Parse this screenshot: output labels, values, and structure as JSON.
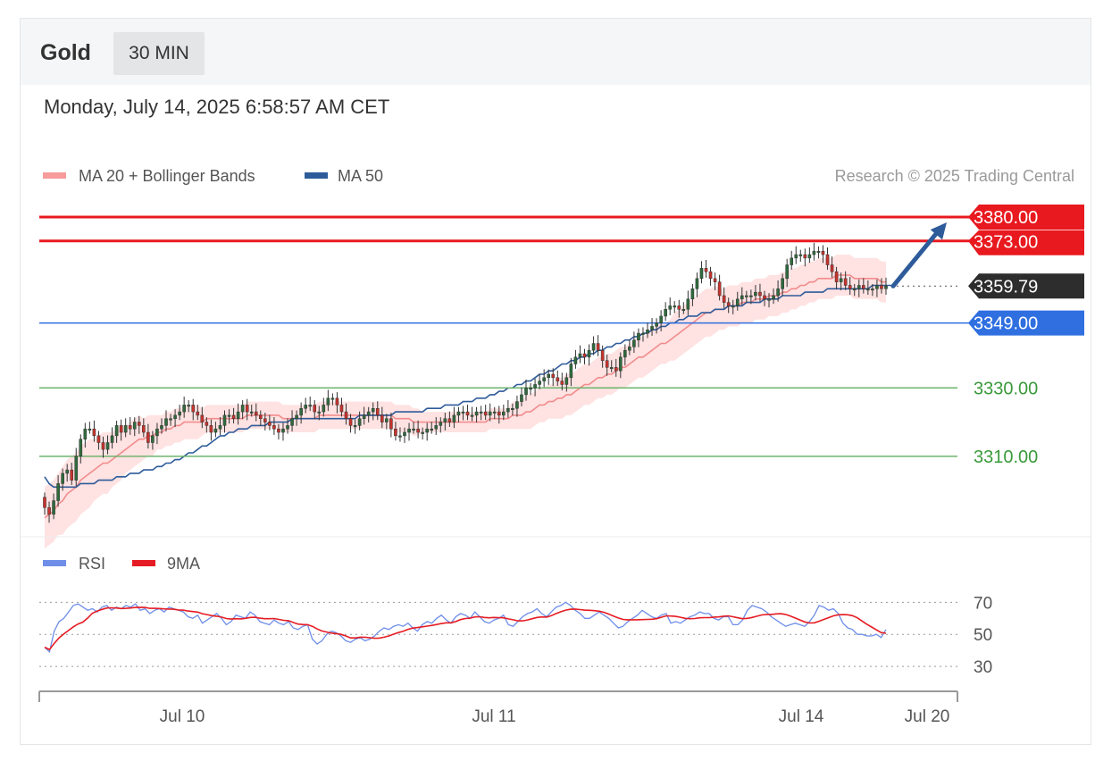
{
  "header": {
    "symbol": "Gold",
    "interval": "30 MIN",
    "datetime": "Monday, July 14, 2025 6:58:57 AM CET"
  },
  "legend": {
    "ma20_bollinger": "MA 20 + Bollinger Bands",
    "ma50": "MA 50",
    "credit": "Research © 2025 Trading Central",
    "rsi": "RSI",
    "rsi_ma": "9MA"
  },
  "colors": {
    "bull": "#2e6b3c",
    "bear": "#c8322d",
    "resistance": "#e8191f",
    "support_primary": "#2f6fe0",
    "support_secondary": "#6db46d",
    "ma20": "#f28c8c",
    "bands": "#ffd6d6",
    "ma50": "#2e5b9a",
    "rsi": "#6e8ee8",
    "rsi_ma": "#e51c23",
    "last_price_bg": "#2d2d2d",
    "arrow": "#2e5b9a"
  },
  "chart_data": {
    "type": "candlestick",
    "ylim": [
      3288,
      3386
    ],
    "x_ticks": [
      "Jul 10",
      "Jul 11",
      "Jul 14",
      "Jul 20"
    ],
    "levels": [
      {
        "value": 3380.0,
        "label": "3380.00",
        "kind": "resistance"
      },
      {
        "value": 3373.0,
        "label": "3373.00",
        "kind": "resistance"
      },
      {
        "value": 3359.79,
        "label": "3359.79",
        "kind": "last"
      },
      {
        "value": 3349.0,
        "label": "3349.00",
        "kind": "pivot"
      },
      {
        "value": 3330.0,
        "label": "3330.00",
        "kind": "support"
      },
      {
        "value": 3310.0,
        "label": "3310.00",
        "kind": "support"
      }
    ],
    "target_arrow": {
      "from": 3359.79,
      "to": 3380.0
    },
    "close": [
      3295,
      3293,
      3297,
      3302,
      3305,
      3306,
      3303,
      3310,
      3315,
      3318,
      3318,
      3316,
      3314,
      3312,
      3314,
      3316,
      3319,
      3317,
      3319,
      3318,
      3320,
      3319,
      3317,
      3314,
      3316,
      3318,
      3319,
      3321,
      3321,
      3322,
      3323,
      3325,
      3325,
      3323,
      3322,
      3320,
      3319,
      3317,
      3318,
      3319,
      3322,
      3322,
      3321,
      3323,
      3325,
      3323,
      3323,
      3322,
      3321,
      3320,
      3319,
      3318,
      3317,
      3318,
      3319,
      3321,
      3322,
      3324,
      3325,
      3325,
      3323,
      3323,
      3325,
      3327,
      3327,
      3325,
      3323,
      3321,
      3319,
      3319,
      3321,
      3322,
      3323,
      3324,
      3322,
      3320,
      3321,
      3318,
      3316,
      3316,
      3317,
      3318,
      3318,
      3317,
      3317,
      3318,
      3318,
      3319,
      3320,
      3321,
      3320,
      3322,
      3323,
      3323,
      3322,
      3322,
      3323,
      3323,
      3322,
      3323,
      3323,
      3322,
      3323,
      3324,
      3324,
      3326,
      3328,
      3330,
      3330,
      3331,
      3332,
      3333,
      3334,
      3333,
      3332,
      3331,
      3333,
      3337,
      3339,
      3340,
      3339,
      3341,
      3343,
      3341,
      3338,
      3336,
      3336,
      3335,
      3339,
      3341,
      3342,
      3344,
      3346,
      3346,
      3347,
      3348,
      3349,
      3351,
      3353,
      3354,
      3354,
      3353,
      3353,
      3356,
      3359,
      3362,
      3365,
      3364,
      3362,
      3361,
      3357,
      3355,
      3354,
      3354,
      3356,
      3357,
      3357,
      3357,
      3358,
      3357,
      3356,
      3356,
      3357,
      3359,
      3362,
      3366,
      3368,
      3369,
      3369,
      3368,
      3369,
      3370,
      3370,
      3369,
      3366,
      3364,
      3361,
      3362,
      3360,
      3359,
      3359,
      3360,
      3359,
      3359,
      3359,
      3360,
      3359,
      3359.79
    ],
    "ma20": [
      3292,
      3293,
      3294,
      3296,
      3297,
      3299,
      3300,
      3301,
      3303,
      3304,
      3305,
      3306,
      3307,
      3308,
      3308,
      3309,
      3310,
      3311,
      3312,
      3313,
      3314,
      3315,
      3315,
      3316,
      3316,
      3317,
      3317,
      3318,
      3318,
      3319,
      3319,
      3320,
      3320,
      3320,
      3320,
      3320,
      3321,
      3321,
      3321,
      3321,
      3321,
      3321,
      3321,
      3321,
      3321,
      3322,
      3322,
      3322,
      3322,
      3322,
      3322,
      3322,
      3322,
      3321,
      3321,
      3321,
      3321,
      3321,
      3321,
      3321,
      3321,
      3322,
      3322,
      3322,
      3322,
      3322,
      3322,
      3322,
      3322,
      3322,
      3322,
      3322,
      3322,
      3322,
      3322,
      3322,
      3322,
      3322,
      3321,
      3321,
      3321,
      3321,
      3320,
      3320,
      3320,
      3320,
      3320,
      3320,
      3320,
      3320,
      3320,
      3320,
      3320,
      3320,
      3320,
      3320,
      3320,
      3320,
      3320,
      3321,
      3321,
      3321,
      3321,
      3321,
      3322,
      3322,
      3322,
      3323,
      3323,
      3324,
      3325,
      3325,
      3326,
      3326,
      3327,
      3327,
      3328,
      3328,
      3329,
      3330,
      3331,
      3331,
      3332,
      3333,
      3333,
      3334,
      3334,
      3335,
      3336,
      3336,
      3337,
      3338,
      3339,
      3339,
      3340,
      3341,
      3342,
      3343,
      3343,
      3344,
      3345,
      3346,
      3347,
      3348,
      3349,
      3350,
      3351,
      3352,
      3352,
      3353,
      3353,
      3353,
      3354,
      3354,
      3354,
      3355,
      3355,
      3355,
      3356,
      3356,
      3356,
      3357,
      3357,
      3357,
      3358,
      3358,
      3359,
      3359,
      3360,
      3360,
      3361,
      3361,
      3362,
      3362,
      3362,
      3362,
      3363,
      3363,
      3363,
      3363,
      3362,
      3362,
      3362,
      3362,
      3362,
      3362,
      3361,
      3361
    ],
    "band_width": [
      9,
      9,
      9,
      9,
      10,
      10,
      10,
      10,
      10,
      10,
      10,
      9,
      9,
      9,
      9,
      8,
      8,
      8,
      7,
      7,
      7,
      7,
      6,
      6,
      6,
      5,
      5,
      5,
      5,
      5,
      5,
      5,
      5,
      5,
      5,
      4,
      4,
      4,
      4,
      4,
      4,
      4,
      4,
      4,
      4,
      4,
      4,
      4,
      4,
      4,
      4,
      4,
      4,
      4,
      4,
      4,
      4,
      4,
      4,
      4,
      4,
      4,
      4,
      4,
      4,
      4,
      4,
      4,
      4,
      4,
      4,
      4,
      4,
      4,
      4,
      4,
      4,
      4,
      4,
      4,
      4,
      4,
      4,
      4,
      3,
      3,
      3,
      3,
      3,
      3,
      3,
      3,
      3,
      3,
      3,
      3,
      3,
      3,
      3,
      3,
      3,
      3,
      3,
      3,
      4,
      4,
      4,
      5,
      5,
      5,
      5,
      5,
      5,
      5,
      6,
      6,
      6,
      6,
      6,
      6,
      6,
      6,
      6,
      6,
      6,
      6,
      6,
      6,
      6,
      6,
      6,
      6,
      6,
      6,
      6,
      6,
      6,
      6,
      6,
      6,
      7,
      7,
      7,
      7,
      7,
      7,
      7,
      7,
      7,
      7,
      6,
      6,
      6,
      6,
      6,
      6,
      6,
      6,
      6,
      6,
      6,
      6,
      6,
      6,
      6,
      6,
      6,
      6,
      6,
      6,
      6,
      6,
      6,
      6,
      6,
      6,
      6,
      6,
      6,
      6,
      6,
      6,
      6,
      6,
      6,
      6,
      6,
      6,
      6
    ],
    "ma50": [
      3304,
      3302,
      3301,
      3301,
      3301,
      3301,
      3301,
      3301,
      3302,
      3302,
      3302,
      3302,
      3303,
      3303,
      3303,
      3303,
      3304,
      3304,
      3304,
      3305,
      3305,
      3305,
      3306,
      3306,
      3306,
      3307,
      3307,
      3308,
      3308,
      3309,
      3309,
      3310,
      3311,
      3311,
      3312,
      3313,
      3313,
      3314,
      3315,
      3316,
      3316,
      3317,
      3317,
      3318,
      3318,
      3318,
      3319,
      3319,
      3319,
      3319,
      3320,
      3320,
      3320,
      3320,
      3320,
      3321,
      3321,
      3321,
      3321,
      3321,
      3321,
      3321,
      3321,
      3321,
      3321,
      3321,
      3321,
      3321,
      3321,
      3321,
      3322,
      3322,
      3322,
      3322,
      3322,
      3322,
      3322,
      3322,
      3323,
      3323,
      3323,
      3323,
      3323,
      3323,
      3323,
      3324,
      3324,
      3324,
      3324,
      3325,
      3325,
      3325,
      3325,
      3326,
      3326,
      3326,
      3327,
      3327,
      3327,
      3328,
      3328,
      3329,
      3329,
      3330,
      3330,
      3331,
      3331,
      3332,
      3332,
      3333,
      3334,
      3334,
      3335,
      3335,
      3336,
      3337,
      3337,
      3338,
      3338,
      3339,
      3339,
      3340,
      3340,
      3341,
      3341,
      3342,
      3342,
      3343,
      3343,
      3344,
      3344,
      3345,
      3345,
      3346,
      3346,
      3347,
      3347,
      3348,
      3348,
      3349,
      3349,
      3350,
      3350,
      3351,
      3351,
      3351,
      3352,
      3352,
      3352,
      3353,
      3353,
      3353,
      3354,
      3354,
      3354,
      3354,
      3355,
      3355,
      3355,
      3355,
      3356,
      3356,
      3356,
      3356,
      3357,
      3357,
      3357,
      3357,
      3357,
      3358,
      3358,
      3358,
      3358,
      3358,
      3359,
      3359,
      3359,
      3359,
      3359,
      3359,
      3359,
      3359,
      3359,
      3359,
      3360,
      3360,
      3360,
      3360,
      3360,
      3360
    ],
    "rsi": {
      "ylim": [
        20,
        78
      ],
      "ticks": [
        70,
        50,
        30
      ],
      "rsi": [
        42,
        39,
        52,
        58,
        60,
        64,
        68,
        69,
        67,
        65,
        66,
        64,
        67,
        68,
        65,
        67,
        66,
        68,
        67,
        69,
        65,
        66,
        63,
        65,
        66,
        64,
        67,
        66,
        65,
        64,
        61,
        60,
        62,
        57,
        59,
        61,
        63,
        60,
        56,
        58,
        62,
        61,
        60,
        64,
        62,
        58,
        57,
        56,
        59,
        57,
        56,
        58,
        54,
        53,
        55,
        56,
        47,
        44,
        46,
        50,
        52,
        51,
        49,
        46,
        45,
        47,
        48,
        46,
        47,
        49,
        52,
        54,
        53,
        55,
        56,
        55,
        57,
        54,
        52,
        56,
        58,
        57,
        60,
        62,
        59,
        57,
        61,
        63,
        62,
        60,
        64,
        61,
        58,
        57,
        59,
        60,
        62,
        56,
        55,
        58,
        61,
        63,
        64,
        66,
        63,
        61,
        64,
        67,
        68,
        70,
        68,
        65,
        63,
        60,
        60,
        62,
        64,
        62,
        60,
        57,
        54,
        55,
        58,
        60,
        62,
        65,
        63,
        61,
        60,
        62,
        63,
        57,
        58,
        57,
        59,
        61,
        62,
        64,
        63,
        63,
        60,
        59,
        61,
        61,
        56,
        56,
        59,
        65,
        68,
        67,
        66,
        64,
        61,
        59,
        57,
        55,
        56,
        57,
        56,
        55,
        58,
        62,
        68,
        67,
        65,
        66,
        63,
        57,
        54,
        53,
        50,
        50,
        49,
        49,
        50,
        48,
        53
      ]
    }
  }
}
